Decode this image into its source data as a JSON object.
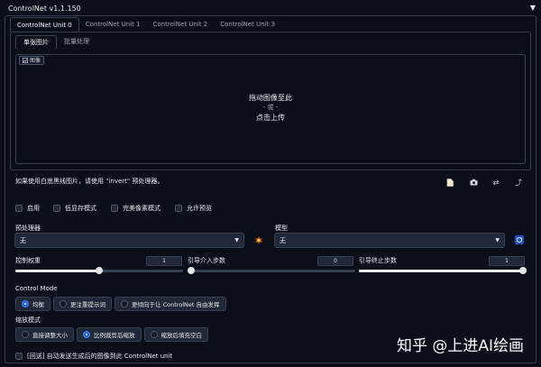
{
  "panel": {
    "title": "ControlNet v1.1.150",
    "collapse_icon": "▼"
  },
  "unit_tabs": [
    {
      "label": "ControlNet Unit 0"
    },
    {
      "label": "ControlNet Unit 1"
    },
    {
      "label": "ControlNet Unit 2"
    },
    {
      "label": "ControlNet Unit 3"
    }
  ],
  "image_tabs": [
    {
      "label": "单张图片"
    },
    {
      "label": "批量处理"
    }
  ],
  "image_upload": {
    "label": "图像",
    "drop_text": "拖动图像至此",
    "or_text": "- 或 -",
    "upload_text": "点击上传"
  },
  "hint": "如果使用白底黑线图片，请使用 \"invert\" 预处理器。",
  "toolbar_icons": [
    "new-canvas-icon",
    "camera-icon",
    "swap-icon",
    "send-dimensions-icon"
  ],
  "checkboxes": [
    {
      "label": "启用",
      "checked": false
    },
    {
      "label": "低显存模式",
      "checked": false
    },
    {
      "label": "完美像素模式",
      "checked": false
    },
    {
      "label": "允许预览",
      "checked": false
    }
  ],
  "preprocessor": {
    "label": "预处理器",
    "value": "无",
    "run_icon": "explosion-icon"
  },
  "model": {
    "label": "模型",
    "value": "无",
    "refresh_icon": "refresh-icon"
  },
  "sliders": [
    {
      "label": "控制权重",
      "value": "1",
      "fraction": 0.5
    },
    {
      "label": "引导介入步数",
      "value": "0",
      "fraction": 0.0
    },
    {
      "label": "引导终止步数",
      "value": "1",
      "fraction": 1.0
    }
  ],
  "control_mode": {
    "label": "Control Mode",
    "options": [
      "均衡",
      "更注重提示词",
      "更倾向于让 ControlNet 自由发挥"
    ],
    "selected": "均衡"
  },
  "resize_mode": {
    "label": "缩放模式",
    "options": [
      "直接调整大小",
      "比例裁剪后缩放",
      "缩放后填充空白"
    ],
    "selected": "比例裁剪后缩放"
  },
  "loopback": {
    "label": "[回送] 自动发送生成后的图像到此 ControlNet unit",
    "checked": false
  },
  "watermark": "知乎 @上进AI绘画",
  "colors": {
    "background": "#0b0f19",
    "accent": "#2563eb",
    "input_bg": "#1f2937",
    "border": "#374151"
  }
}
